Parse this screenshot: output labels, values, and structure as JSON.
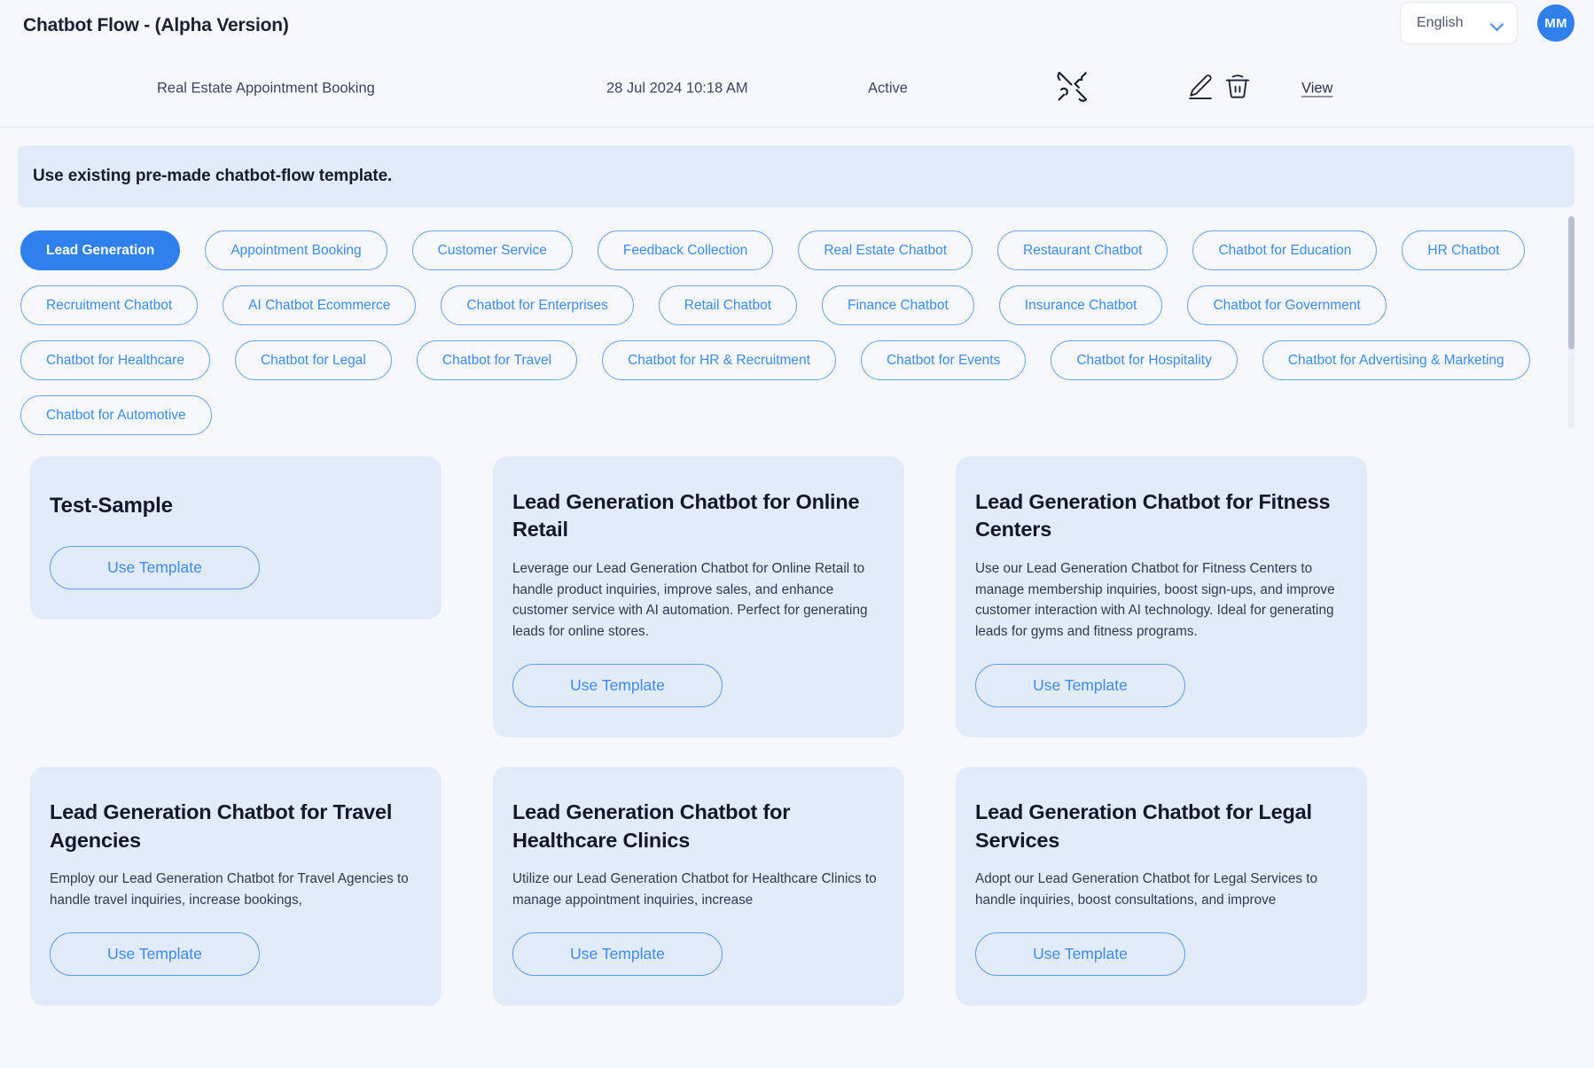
{
  "header": {
    "title": "Chatbot Flow - (Alpha Version)",
    "language": "English",
    "avatar_initials": "MM"
  },
  "subheader": {
    "flow_name": "Real Estate Appointment Booking",
    "datetime": "28 Jul 2024 10:18 AM",
    "status": "Active",
    "view_label": "View",
    "icons": [
      "tools-icon",
      "pen-icon",
      "trash-icon"
    ]
  },
  "banner": {
    "text": "Use existing pre-made chatbot-flow template."
  },
  "categories": [
    {
      "label": "Lead Generation",
      "active": true
    },
    {
      "label": "Appointment Booking",
      "active": false
    },
    {
      "label": "Customer Service",
      "active": false
    },
    {
      "label": "Feedback Collection",
      "active": false
    },
    {
      "label": "Real Estate Chatbot",
      "active": false
    },
    {
      "label": "Restaurant Chatbot",
      "active": false
    },
    {
      "label": "Chatbot for Education",
      "active": false
    },
    {
      "label": "HR Chatbot",
      "active": false
    },
    {
      "label": "Recruitment Chatbot",
      "active": false
    },
    {
      "label": "AI Chatbot Ecommerce",
      "active": false
    },
    {
      "label": "Chatbot for Enterprises",
      "active": false
    },
    {
      "label": "Retail Chatbot",
      "active": false
    },
    {
      "label": "Finance Chatbot",
      "active": false
    },
    {
      "label": "Insurance Chatbot",
      "active": false
    },
    {
      "label": "Chatbot for Government",
      "active": false
    },
    {
      "label": "Chatbot for Healthcare",
      "active": false
    },
    {
      "label": "Chatbot for Legal",
      "active": false
    },
    {
      "label": "Chatbot for Travel",
      "active": false
    },
    {
      "label": "Chatbot for HR & Recruitment",
      "active": false
    },
    {
      "label": "Chatbot for Events",
      "active": false
    },
    {
      "label": "Chatbot for Hospitality",
      "active": false
    },
    {
      "label": "Chatbot for Advertising & Marketing",
      "active": false
    },
    {
      "label": "Chatbot for Automotive",
      "active": false
    }
  ],
  "templates": [
    {
      "title": "Test-Sample",
      "description": "",
      "button": "Use Template"
    },
    {
      "title": "Lead Generation Chatbot for Online Retail",
      "description": "Leverage our Lead Generation Chatbot for Online Retail to handle product inquiries, improve sales, and enhance customer service with AI automation. Perfect for generating leads for online stores.",
      "button": "Use Template"
    },
    {
      "title": "Lead Generation Chatbot for Fitness Centers",
      "description": "Use our Lead Generation Chatbot for Fitness Centers to manage membership inquiries, boost sign-ups, and improve customer interaction with AI technology. Ideal for generating leads for gyms and fitness programs.",
      "button": "Use Template"
    },
    {
      "title": "Lead Generation Chatbot for Travel Agencies",
      "description": "Employ our Lead Generation Chatbot for Travel Agencies to handle travel inquiries, increase bookings,",
      "button": "Use Template"
    },
    {
      "title": "Lead Generation Chatbot for Healthcare Clinics",
      "description": "Utilize our Lead Generation Chatbot for Healthcare Clinics to manage appointment inquiries, increase",
      "button": "Use Template"
    },
    {
      "title": "Lead Generation Chatbot for Legal Services",
      "description": "Adopt our Lead Generation Chatbot for Legal Services to handle inquiries, boost consultations, and improve",
      "button": "Use Template"
    }
  ],
  "colors": {
    "accent": "#2f80ed",
    "chip_border": "#6ba5f0",
    "card_bg": "#e2ebfa",
    "page_bg": "#f7f8fc"
  }
}
